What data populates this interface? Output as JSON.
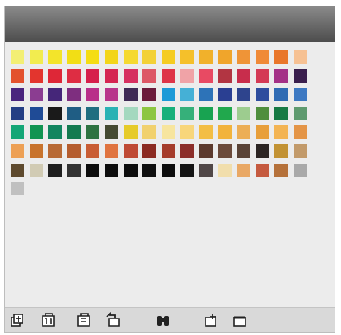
{
  "panel": {
    "title_text": ""
  },
  "swatches": {
    "rows": [
      [
        "#f3ef74",
        "#f2ec4f",
        "#f3e42a",
        "#f2de15",
        "#f5dd13",
        "#f3d51a",
        "#f5d930",
        "#f3d136",
        "#f5cc22",
        "#f5c02a",
        "#f1b12b",
        "#f0a52b",
        "#ef9437",
        "#f08a37",
        "#e9762a",
        "#f6c193"
      ],
      [
        "#e3522d",
        "#e3352e",
        "#de2737",
        "#de2d43",
        "#d61f4b",
        "#d52552",
        "#d63060",
        "#dd5866",
        "#de3548",
        "#f0a3a7",
        "#e84a63",
        "#b23542",
        "#c82d4c",
        "#d43a55",
        "#a43186",
        "#3a1f4d"
      ],
      [
        "#4a257e",
        "#8b3d91",
        "#452679",
        "#7e2e7f",
        "#b92f89",
        "#b8358b",
        "#3f2a55",
        "#6b1b3b",
        "#1d9ad7",
        "#45b0d6",
        "#2d73b8",
        "#2a3f92",
        "#2e448d",
        "#2e4d9e",
        "#2f6bb3",
        "#3d79c2"
      ],
      [
        "#243e84",
        "#1f4b96",
        "#1a1a1a",
        "#1f5d84",
        "#1f6e80",
        "#29b2b4",
        "#a4d8bf",
        "#8dc641",
        "#18b07b",
        "#36b07a",
        "#18a351",
        "#21a84d",
        "#9dcc8f",
        "#4f8e3d",
        "#177a44",
        "#5e9a6f"
      ],
      [
        "#14a676",
        "#119451",
        "#12855f",
        "#147a4f",
        "#2e7341",
        "#444a32",
        "#e6cb2a",
        "#f1d16e",
        "#f7e59e",
        "#f8d67a",
        "#f3be44",
        "#f2b33c",
        "#ecae56",
        "#e89f3a",
        "#f3b453",
        "#e49547"
      ],
      [
        "#eda055",
        "#c8732c",
        "#b86a35",
        "#b55d2e",
        "#c95d34",
        "#e07440",
        "#bf4a34",
        "#8c2b22",
        "#a53c2b",
        "#8c2e2a",
        "#5c3a2d",
        "#6b4a3a",
        "#5a4336",
        "#2c2523",
        "#c29233",
        "#c29a6a"
      ],
      [
        "#5e4a2e",
        "#d1cbb4",
        "#1f1f1f",
        "#333333",
        "#0d0d0d",
        "#0d0d0d",
        "#0d0d0d",
        "#0f0f0f",
        "#0c0c0c",
        "#151515",
        "#504747",
        "#f1deac",
        "#e9a865",
        "#c55a3f",
        "#b5713a",
        "#a9a9a9",
        "#c0c0c0"
      ]
    ]
  },
  "toolbar": {
    "icons": [
      "add-swatch-icon",
      "library-icon",
      "library-open-icon",
      "library-undo-icon",
      "find-icon",
      "new-swatch-icon",
      "new-folder-icon"
    ]
  },
  "colors": {
    "panel_bg": "#e6e6e6",
    "titlebar_top": "#8a8a8a",
    "titlebar_bottom": "#4d4d4d"
  }
}
